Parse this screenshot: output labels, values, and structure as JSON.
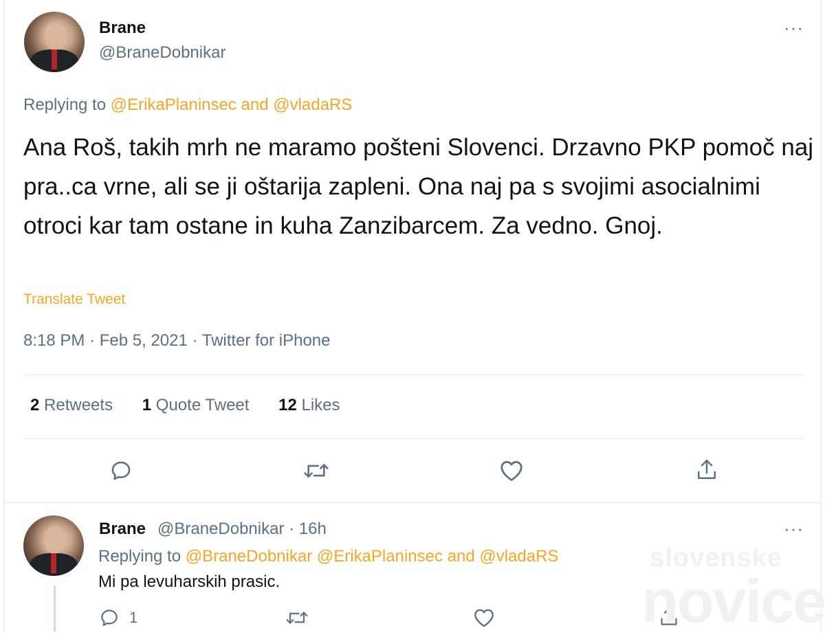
{
  "main_tweet": {
    "author_name": "Brane",
    "author_handle": "@BraneDobnikar",
    "more_icon": "more-horizontal-icon",
    "replying_prefix": "Replying to ",
    "replying_mentions": "@ErikaPlaninsec and @vladaRS",
    "text": "Ana Roš, takih mrh ne maramo pošteni Slovenci. Drzavno PKP pomoč naj pra..ca vrne, ali se ji oštarija zapleni. Ona naj pa s svojimi asocialnimi otroci kar tam ostane in kuha Zanzibarcem. Za vedno. Gnoj.",
    "translate_label": "Translate Tweet",
    "time": "8:18 PM",
    "date": "Feb 5, 2021",
    "source": "Twitter for iPhone",
    "retweets_count": "2",
    "retweets_label": "Retweets",
    "quotes_count": "1",
    "quotes_label": "Quote Tweet",
    "likes_count": "12",
    "likes_label": "Likes",
    "actions": [
      "reply-icon",
      "retweet-icon",
      "like-icon",
      "share-icon"
    ]
  },
  "reply_tweet": {
    "author_name": "Brane",
    "author_handle": "@BraneDobnikar",
    "time_ago": "16h",
    "replying_prefix": "Replying to ",
    "replying_mentions": "@BraneDobnikar @ErikaPlaninsec and @vladaRS",
    "text": "Mi pa levuharskih prasic.",
    "reply_count": "1"
  },
  "watermark": {
    "line1": "slovenske",
    "line2": "novice"
  },
  "colors": {
    "accent": "#f5a623",
    "secondary_text": "#5b7083",
    "primary_text": "#0f1419",
    "divider": "#e1e8ed"
  }
}
